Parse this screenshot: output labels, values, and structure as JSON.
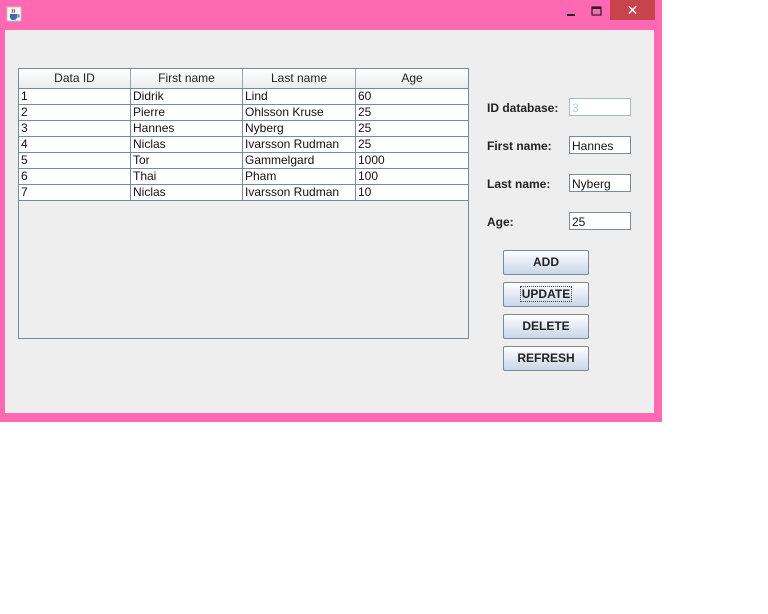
{
  "window": {
    "frame_color": "#ff69b4",
    "close_color": "#c8444c",
    "icons": {
      "app": "java-cup-icon",
      "minimize": "minimize-icon",
      "maximize": "maximize-icon",
      "close": "close-icon"
    },
    "close_glyph": "✕"
  },
  "table": {
    "columns": [
      "Data ID",
      "First name",
      "Last name",
      "Age"
    ],
    "rows": [
      [
        "1",
        "Didrik",
        "Lind",
        "60"
      ],
      [
        "2",
        "Pierre",
        "Ohlsson Kruse",
        "25"
      ],
      [
        "3",
        "Hannes",
        "Nyberg",
        "25"
      ],
      [
        "4",
        "Niclas",
        "Ivarsson Rudman",
        "25"
      ],
      [
        "5",
        "Tor",
        "Gammelgard",
        "1000"
      ],
      [
        "6",
        "Thai",
        "Pham",
        "100"
      ],
      [
        "7",
        "Niclas",
        "Ivarsson Rudman",
        "10"
      ]
    ]
  },
  "form": {
    "id_label": "ID database:",
    "id_value": "3",
    "first_label": "First name:",
    "first_value": "Hannes",
    "last_label": "Last name:",
    "last_value": "Nyberg",
    "age_label": "Age:",
    "age_value": "25"
  },
  "buttons": {
    "add": "ADD",
    "update": "UPDATE",
    "delete": "DELETE",
    "refresh": "REFRESH"
  }
}
